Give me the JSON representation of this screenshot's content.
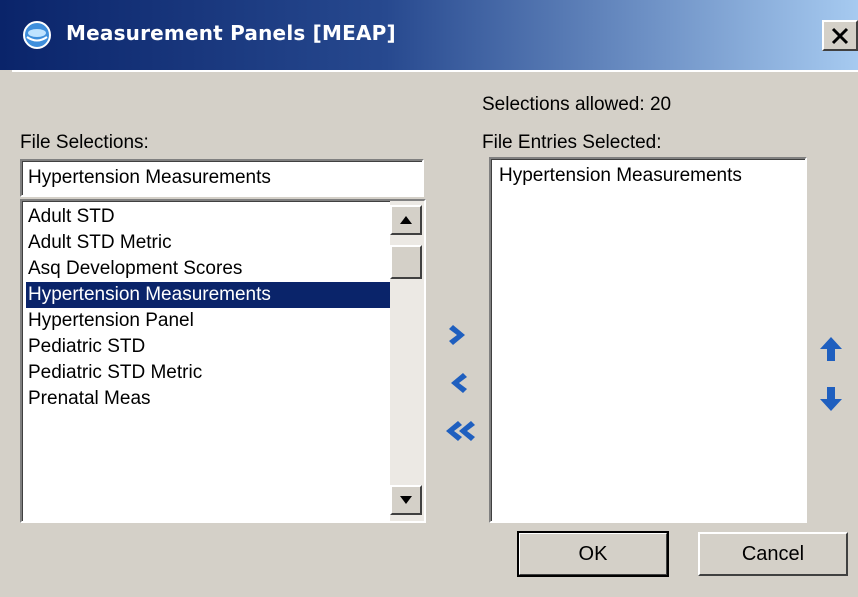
{
  "window": {
    "title": "Measurement Panels [MEAP]",
    "close_label": "✕",
    "title_bar_gradient": [
      "#0a246a",
      "#a6caf0"
    ]
  },
  "left": {
    "label": "File Selections:",
    "search_value": "Hypertension Measurements",
    "items": [
      "Adult STD",
      "Adult STD Metric",
      "Asq Development Scores",
      "Hypertension Measurements",
      "Hypertension Panel",
      "Pediatric STD",
      "Pediatric STD Metric",
      "Prenatal Meas"
    ],
    "selected_index": 3
  },
  "right": {
    "allowed_label": "Selections allowed:",
    "allowed_count": "20",
    "label": "File Entries Selected:",
    "items": [
      "Hypertension Measurements"
    ]
  },
  "buttons": {
    "ok": "OK",
    "cancel": "Cancel"
  },
  "icons": {
    "add": "chevron-right-icon",
    "remove": "chevron-left-icon",
    "remove_all": "double-chevron-left-icon",
    "move_up": "arrow-up-icon",
    "move_down": "arrow-down-icon"
  },
  "colors": {
    "selection_bg": "#0a246a",
    "accent_blue": "#1f5fbf",
    "dialog_bg": "#d4d0c8"
  }
}
